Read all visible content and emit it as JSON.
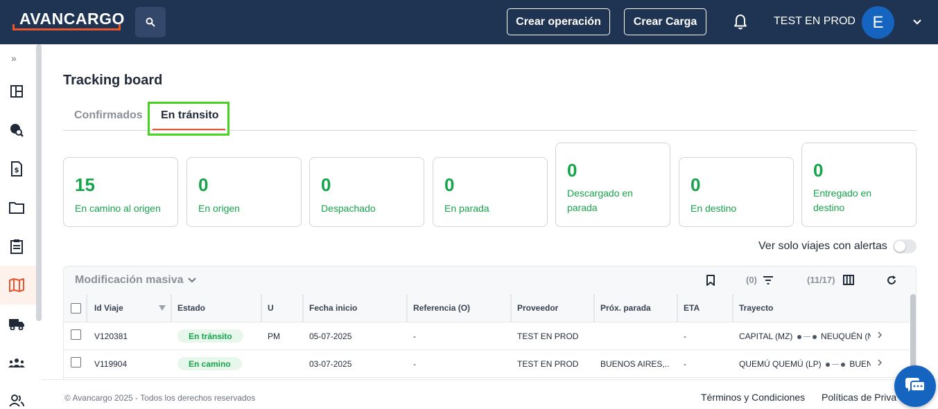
{
  "header": {
    "logo_text": "AVANCARGO",
    "create_operation_label": "Crear operación",
    "create_load_label": "Crear Carga",
    "user_name": "TEST EN PROD",
    "avatar_initial": "E"
  },
  "page": {
    "title": "Tracking board",
    "tabs": [
      {
        "label": "Confirmados"
      },
      {
        "label": "En tránsito"
      }
    ]
  },
  "status_cards": [
    {
      "count": "15",
      "label": "En camino al origen"
    },
    {
      "count": "0",
      "label": "En origen"
    },
    {
      "count": "0",
      "label": "Despachado"
    },
    {
      "count": "0",
      "label": "En parada"
    },
    {
      "count": "0",
      "label": "Descargado en parada"
    },
    {
      "count": "0",
      "label": "En destino"
    },
    {
      "count": "0",
      "label": "Entregado en destino"
    }
  ],
  "alerts_toggle_label": "Ver solo viajes con alertas",
  "toolbar": {
    "bulk_edit_label": "Modificación masiva",
    "filter_count": "(0)",
    "columns_count": "(11/17)"
  },
  "table": {
    "columns": [
      "Id Viaje",
      "Estado",
      "U",
      "Fecha inicio",
      "Referencia (O)",
      "Proveedor",
      "Próx. parada",
      "ETA",
      "Trayecto"
    ],
    "rows": [
      {
        "id": "V120381",
        "estado": "En tránsito",
        "u": "PM",
        "fecha": "05-07-2025",
        "referencia": "-",
        "proveedor": "TEST EN PROD",
        "prox_parada": "",
        "eta": "-",
        "trayecto_origen": "CAPITAL (MZ)",
        "trayecto_destino": "NEUQUÉN (N"
      },
      {
        "id": "V119904",
        "estado": "En camino",
        "u": "",
        "fecha": "03-07-2025",
        "referencia": "-",
        "proveedor": "TEST EN PROD",
        "prox_parada": "BUENOS AIRES,...",
        "eta": "-",
        "trayecto_origen": "QUEMÚ QUEMÚ (LP)",
        "trayecto_destino": "BUENO"
      }
    ]
  },
  "footer": {
    "copyright": "© Avancargo 2025 - Todos los derechos reservados",
    "terms": "Términos y Condiciones",
    "privacy": "Políticas de Priva"
  },
  "colors": {
    "header_bg": "#1f3353",
    "accent": "#e8542c",
    "success": "#16a34a",
    "highlight_box": "#43d61c"
  }
}
